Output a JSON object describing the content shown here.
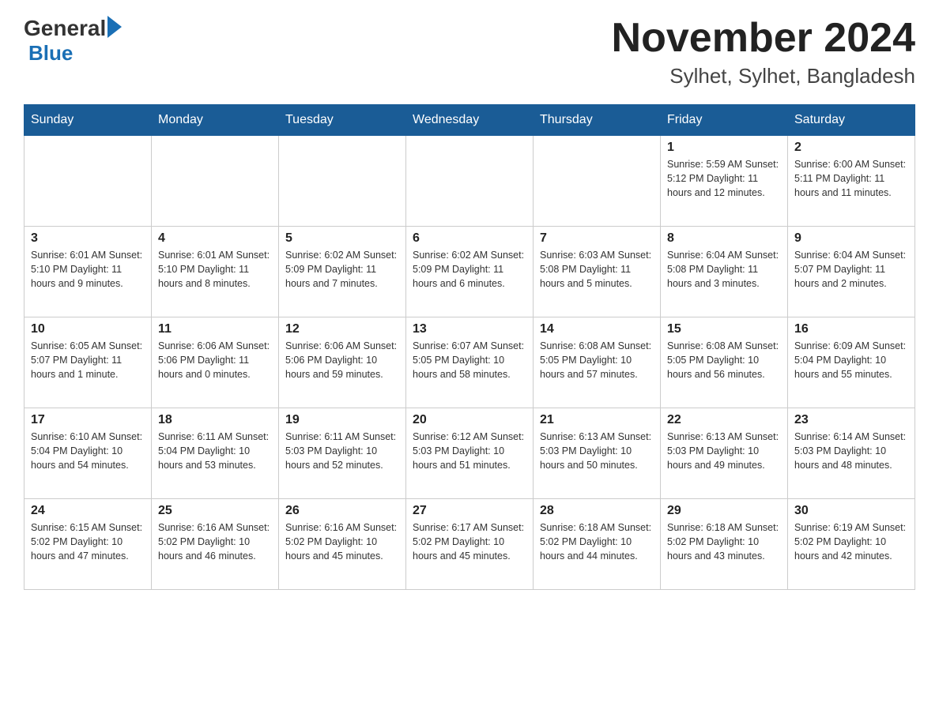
{
  "header": {
    "title": "November 2024",
    "subtitle": "Sylhet, Sylhet, Bangladesh",
    "logo_general": "General",
    "logo_blue": "Blue"
  },
  "days_of_week": [
    "Sunday",
    "Monday",
    "Tuesday",
    "Wednesday",
    "Thursday",
    "Friday",
    "Saturday"
  ],
  "weeks": [
    {
      "cells": [
        {
          "day": "",
          "info": ""
        },
        {
          "day": "",
          "info": ""
        },
        {
          "day": "",
          "info": ""
        },
        {
          "day": "",
          "info": ""
        },
        {
          "day": "",
          "info": ""
        },
        {
          "day": "1",
          "info": "Sunrise: 5:59 AM\nSunset: 5:12 PM\nDaylight: 11 hours\nand 12 minutes."
        },
        {
          "day": "2",
          "info": "Sunrise: 6:00 AM\nSunset: 5:11 PM\nDaylight: 11 hours\nand 11 minutes."
        }
      ]
    },
    {
      "cells": [
        {
          "day": "3",
          "info": "Sunrise: 6:01 AM\nSunset: 5:10 PM\nDaylight: 11 hours\nand 9 minutes."
        },
        {
          "day": "4",
          "info": "Sunrise: 6:01 AM\nSunset: 5:10 PM\nDaylight: 11 hours\nand 8 minutes."
        },
        {
          "day": "5",
          "info": "Sunrise: 6:02 AM\nSunset: 5:09 PM\nDaylight: 11 hours\nand 7 minutes."
        },
        {
          "day": "6",
          "info": "Sunrise: 6:02 AM\nSunset: 5:09 PM\nDaylight: 11 hours\nand 6 minutes."
        },
        {
          "day": "7",
          "info": "Sunrise: 6:03 AM\nSunset: 5:08 PM\nDaylight: 11 hours\nand 5 minutes."
        },
        {
          "day": "8",
          "info": "Sunrise: 6:04 AM\nSunset: 5:08 PM\nDaylight: 11 hours\nand 3 minutes."
        },
        {
          "day": "9",
          "info": "Sunrise: 6:04 AM\nSunset: 5:07 PM\nDaylight: 11 hours\nand 2 minutes."
        }
      ]
    },
    {
      "cells": [
        {
          "day": "10",
          "info": "Sunrise: 6:05 AM\nSunset: 5:07 PM\nDaylight: 11 hours\nand 1 minute."
        },
        {
          "day": "11",
          "info": "Sunrise: 6:06 AM\nSunset: 5:06 PM\nDaylight: 11 hours\nand 0 minutes."
        },
        {
          "day": "12",
          "info": "Sunrise: 6:06 AM\nSunset: 5:06 PM\nDaylight: 10 hours\nand 59 minutes."
        },
        {
          "day": "13",
          "info": "Sunrise: 6:07 AM\nSunset: 5:05 PM\nDaylight: 10 hours\nand 58 minutes."
        },
        {
          "day": "14",
          "info": "Sunrise: 6:08 AM\nSunset: 5:05 PM\nDaylight: 10 hours\nand 57 minutes."
        },
        {
          "day": "15",
          "info": "Sunrise: 6:08 AM\nSunset: 5:05 PM\nDaylight: 10 hours\nand 56 minutes."
        },
        {
          "day": "16",
          "info": "Sunrise: 6:09 AM\nSunset: 5:04 PM\nDaylight: 10 hours\nand 55 minutes."
        }
      ]
    },
    {
      "cells": [
        {
          "day": "17",
          "info": "Sunrise: 6:10 AM\nSunset: 5:04 PM\nDaylight: 10 hours\nand 54 minutes."
        },
        {
          "day": "18",
          "info": "Sunrise: 6:11 AM\nSunset: 5:04 PM\nDaylight: 10 hours\nand 53 minutes."
        },
        {
          "day": "19",
          "info": "Sunrise: 6:11 AM\nSunset: 5:03 PM\nDaylight: 10 hours\nand 52 minutes."
        },
        {
          "day": "20",
          "info": "Sunrise: 6:12 AM\nSunset: 5:03 PM\nDaylight: 10 hours\nand 51 minutes."
        },
        {
          "day": "21",
          "info": "Sunrise: 6:13 AM\nSunset: 5:03 PM\nDaylight: 10 hours\nand 50 minutes."
        },
        {
          "day": "22",
          "info": "Sunrise: 6:13 AM\nSunset: 5:03 PM\nDaylight: 10 hours\nand 49 minutes."
        },
        {
          "day": "23",
          "info": "Sunrise: 6:14 AM\nSunset: 5:03 PM\nDaylight: 10 hours\nand 48 minutes."
        }
      ]
    },
    {
      "cells": [
        {
          "day": "24",
          "info": "Sunrise: 6:15 AM\nSunset: 5:02 PM\nDaylight: 10 hours\nand 47 minutes."
        },
        {
          "day": "25",
          "info": "Sunrise: 6:16 AM\nSunset: 5:02 PM\nDaylight: 10 hours\nand 46 minutes."
        },
        {
          "day": "26",
          "info": "Sunrise: 6:16 AM\nSunset: 5:02 PM\nDaylight: 10 hours\nand 45 minutes."
        },
        {
          "day": "27",
          "info": "Sunrise: 6:17 AM\nSunset: 5:02 PM\nDaylight: 10 hours\nand 45 minutes."
        },
        {
          "day": "28",
          "info": "Sunrise: 6:18 AM\nSunset: 5:02 PM\nDaylight: 10 hours\nand 44 minutes."
        },
        {
          "day": "29",
          "info": "Sunrise: 6:18 AM\nSunset: 5:02 PM\nDaylight: 10 hours\nand 43 minutes."
        },
        {
          "day": "30",
          "info": "Sunrise: 6:19 AM\nSunset: 5:02 PM\nDaylight: 10 hours\nand 42 minutes."
        }
      ]
    }
  ]
}
